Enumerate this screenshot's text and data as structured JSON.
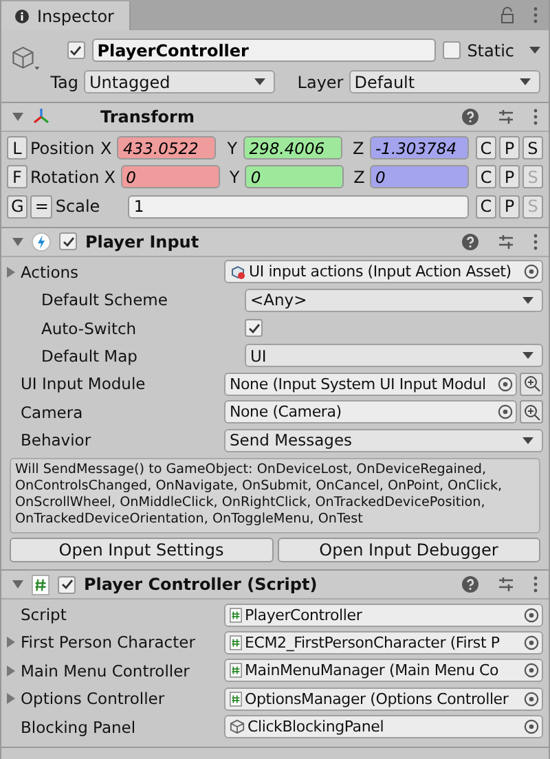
{
  "tab": {
    "title": "Inspector"
  },
  "object": {
    "active": true,
    "name": "PlayerController",
    "static": false,
    "static_label": "Static",
    "tag_label": "Tag",
    "tag": "Untagged",
    "layer_label": "Layer",
    "layer": "Default"
  },
  "components": [
    {
      "kind": "transform",
      "title": "Transform",
      "expanded": true,
      "rows": [
        {
          "kind": "vector",
          "tool": "L",
          "label": "Position",
          "axes": [
            {
              "axis": "X",
              "value": "433.0522",
              "color": "#f09c9c"
            },
            {
              "axis": "Y",
              "value": "298.4006",
              "color": "#9ee89c"
            },
            {
              "axis": "Z",
              "value": "-1.303784",
              "color": "#a4a4ee"
            }
          ],
          "buttons": [
            {
              "label": "C",
              "disabled": false
            },
            {
              "label": "P",
              "disabled": false
            },
            {
              "label": "S",
              "disabled": false
            }
          ]
        },
        {
          "kind": "vector",
          "tool": "F",
          "label": "Rotation",
          "axes": [
            {
              "axis": "X",
              "value": "0",
              "color": "#f09c9c"
            },
            {
              "axis": "Y",
              "value": "0",
              "color": "#9ee89c"
            },
            {
              "axis": "Z",
              "value": "0",
              "color": "#a4a4ee"
            }
          ],
          "buttons": [
            {
              "label": "C",
              "disabled": false
            },
            {
              "label": "P",
              "disabled": false
            },
            {
              "label": "S",
              "disabled": true
            }
          ]
        },
        {
          "kind": "uniform",
          "tool": "G",
          "lock": "=",
          "label": "Scale",
          "value": "1",
          "buttons": [
            {
              "label": "C",
              "disabled": false
            },
            {
              "label": "P",
              "disabled": false
            },
            {
              "label": "S",
              "disabled": true
            }
          ]
        }
      ]
    },
    {
      "kind": "input",
      "title": "Player Input",
      "enabled": true,
      "expanded": true,
      "fields": [
        {
          "kind": "asset",
          "label": "Actions",
          "foldout": true,
          "value": "UI input actions (Input Action Asset)",
          "inspect": false,
          "children": [
            {
              "kind": "dropdown",
              "label": "Default Scheme",
              "foldout": false,
              "value": "<Any>"
            },
            {
              "kind": "checkbox",
              "label": "Auto-Switch",
              "foldout": false,
              "checked": true
            },
            {
              "kind": "dropdown",
              "label": "Default Map",
              "foldout": false,
              "value": "UI"
            }
          ]
        },
        {
          "kind": "reference",
          "label": "UI Input Module",
          "foldout": false,
          "value": "None (Input System UI Input Modul",
          "inspect": true
        },
        {
          "kind": "reference",
          "label": "Camera",
          "foldout": false,
          "value": "None (Camera)",
          "inspect": true
        },
        {
          "kind": "dropdown",
          "label": "Behavior",
          "foldout": false,
          "value": "Send Messages"
        }
      ],
      "help": "Will SendMessage() to GameObject: OnDeviceLost, OnDeviceRegained, OnControlsChanged, OnNavigate, OnSubmit, OnCancel, OnPoint, OnClick, OnScrollWheel, OnMiddleClick, OnRightClick, OnTrackedDevicePosition, OnTrackedDeviceOrientation, OnToggleMenu, OnTest",
      "buttons": [
        "Open Input Settings",
        "Open Input Debugger"
      ]
    },
    {
      "kind": "script",
      "title": "Player Controller (Script)",
      "enabled": true,
      "expanded": true,
      "fields": [
        {
          "kind": "script",
          "label": "Script",
          "foldout": false,
          "value": "PlayerController",
          "inspect": false
        },
        {
          "kind": "script",
          "label": "First Person Character",
          "foldout": true,
          "value": "ECM2_FirstPersonCharacter (First P",
          "inspect": false
        },
        {
          "kind": "script",
          "label": "Main Menu Controller",
          "foldout": true,
          "value": "MainMenuManager (Main Menu Co",
          "inspect": false
        },
        {
          "kind": "script",
          "label": "Options Controller",
          "foldout": true,
          "value": "OptionsManager (Options Controller",
          "inspect": false
        },
        {
          "kind": "gameobject",
          "label": "Blocking Panel",
          "foldout": false,
          "value": "ClickBlockingPanel",
          "inspect": false
        }
      ]
    }
  ]
}
